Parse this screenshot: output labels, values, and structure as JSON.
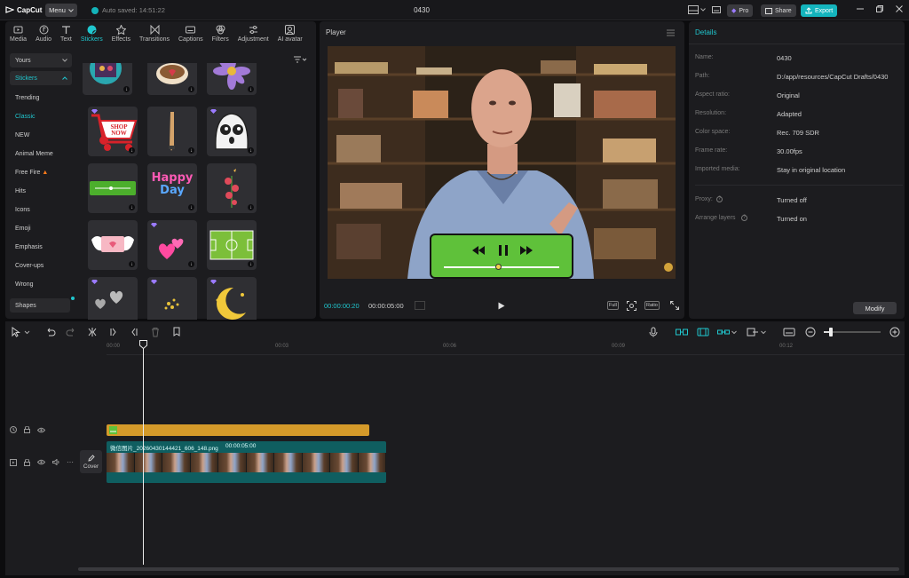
{
  "titlebar": {
    "app_name": "CapCut",
    "menu_label": "Menu",
    "autosave": "Auto saved: 14:51:22",
    "project_title": "0430",
    "pro_label": "Pro",
    "share_label": "Share",
    "export_label": "Export"
  },
  "media_toolbar": [
    {
      "label": "Media",
      "icon": "media-icon"
    },
    {
      "label": "Audio",
      "icon": "audio-icon"
    },
    {
      "label": "Text",
      "icon": "text-icon"
    },
    {
      "label": "Stickers",
      "icon": "stickers-icon",
      "active": true
    },
    {
      "label": "Effects",
      "icon": "effects-icon"
    },
    {
      "label": "Transitions",
      "icon": "transitions-icon"
    },
    {
      "label": "Captions",
      "icon": "captions-icon"
    },
    {
      "label": "Filters",
      "icon": "filters-icon"
    },
    {
      "label": "Adjustment",
      "icon": "adjustment-icon"
    },
    {
      "label": "AI avatar",
      "icon": "ai-avatar-icon"
    }
  ],
  "sticker_sidebar": {
    "yours": "Yours",
    "stickers": "Stickers",
    "items": [
      "Trending",
      "Classic",
      "NEW",
      "Animal Meme",
      "Free Fire",
      "Hits",
      "Icons",
      "Emoji",
      "Emphasis",
      "Cover-ups",
      "Wrong"
    ],
    "shapes": "Shapes"
  },
  "sticker_text": {
    "shop_now": "SHOP NOW",
    "happy": "Happy",
    "day": "Day"
  },
  "player": {
    "title": "Player",
    "current_time": "00:00:00:20",
    "total_time": "00:00:05:00",
    "full_label": "Full",
    "ratio_label": "Ratio",
    "progress": 0.46
  },
  "details": {
    "title": "Details",
    "rows": [
      {
        "label": "Name:",
        "value": "0430"
      },
      {
        "label": "Path:",
        "value": "D:/app/resources/CapCut Drafts/0430"
      },
      {
        "label": "Aspect ratio:",
        "value": "Original"
      },
      {
        "label": "Resolution:",
        "value": "Adapted"
      },
      {
        "label": "Color space:",
        "value": "Rec. 709 SDR"
      },
      {
        "label": "Frame rate:",
        "value": "30.00fps"
      },
      {
        "label": "Imported media:",
        "value": "Stay in original location"
      }
    ],
    "rows2": [
      {
        "label": "Proxy:",
        "value": "Turned off"
      },
      {
        "label": "Arrange layers",
        "value": "Turned on"
      }
    ],
    "modify_label": "Modify"
  },
  "timeline": {
    "ticks": [
      "00:00",
      "00:03",
      "00:06",
      "00:09",
      "00:12"
    ],
    "clip_name": "微信图片_20260430144421_606_148.png",
    "clip_duration": "00:00:05:00",
    "cover_label": "Cover"
  },
  "colors": {
    "accent": "#20c7cf",
    "sticker_track": "#d49a2a",
    "video_track": "#0f5e60",
    "overlay_green": "#5fc13a"
  }
}
